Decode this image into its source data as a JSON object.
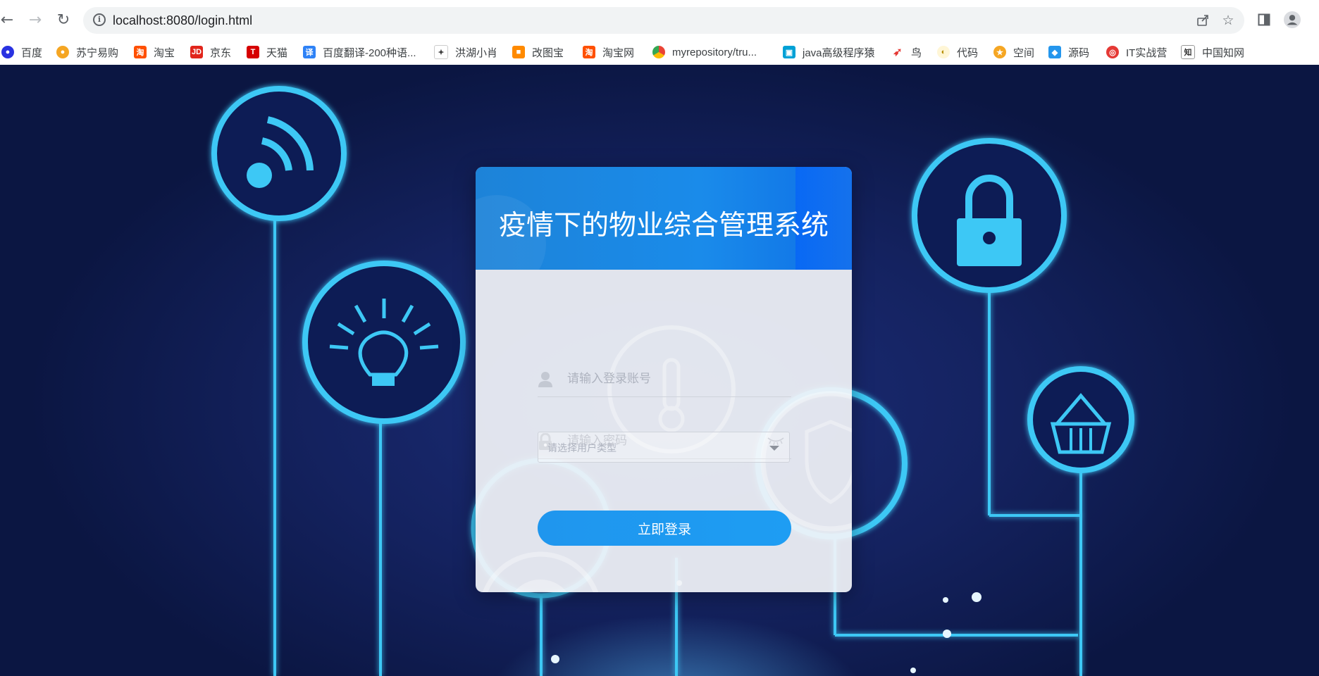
{
  "browser": {
    "url": "localhost:8080/login.html",
    "bookmarks": [
      {
        "label": "百度",
        "icon": "baidu-paw-icon",
        "color": "#2932e1"
      },
      {
        "label": "苏宁易购",
        "icon": "suning-lion-icon",
        "color": "#f5a623"
      },
      {
        "label": "淘宝",
        "icon": "taobao-icon",
        "color": "#ff5000"
      },
      {
        "label": "京东",
        "icon": "jd-icon",
        "color": "#e1251b"
      },
      {
        "label": "天猫",
        "icon": "tmall-icon",
        "color": "#d60000"
      },
      {
        "label": "百度翻译-200种语...",
        "icon": "translate-icon",
        "color": "#2e82f6"
      },
      {
        "label": "洪湖小肖",
        "icon": "bird-icon",
        "color": "#444444"
      },
      {
        "label": "改图宝",
        "icon": "gaitubao-icon",
        "color": "#ff8a00"
      },
      {
        "label": "淘宝网",
        "icon": "taobao-icon",
        "color": "#ff5000"
      },
      {
        "label": "myrepository/tru...",
        "icon": "chrome-icon",
        "color": "#34a853"
      },
      {
        "label": "java高级程序猿",
        "icon": "bilibili-icon",
        "color": "#00a1d6"
      },
      {
        "label": "鸟",
        "icon": "red-bird-icon",
        "color": "#e53935"
      },
      {
        "label": "代码",
        "icon": "code-icon",
        "color": "#f9d56e"
      },
      {
        "label": "空间",
        "icon": "qzone-icon",
        "color": "#f5a623"
      },
      {
        "label": "源码",
        "icon": "docker-icon",
        "color": "#2496ed"
      },
      {
        "label": "IT实战营",
        "icon": "it-camp-icon",
        "color": "#e53935"
      },
      {
        "label": "中国知网",
        "icon": "cnki-icon",
        "color": "#333333"
      }
    ]
  },
  "login": {
    "title": "疫情下的物业综合管理系统",
    "account_placeholder": "请输入登录账号",
    "password_placeholder": "请输入密码",
    "user_type_placeholder": "请选择用户类型",
    "submit_label": "立即登录"
  },
  "colors": {
    "header_blue": "#1a8bea",
    "button_blue": "#1e9af1",
    "background_navy": "#14225f",
    "neon_cyan": "#3cc8f5"
  }
}
